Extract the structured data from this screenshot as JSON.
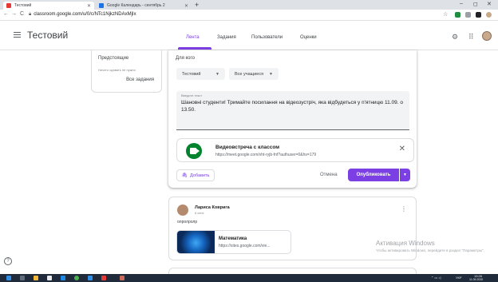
{
  "browser": {
    "tabs": [
      {
        "title": "Тестовий",
        "active": true,
        "color": "#e53935"
      },
      {
        "title": "Google Календарь - сентябрь 2",
        "active": false,
        "color": "#1a73e8"
      }
    ],
    "new_tab": "+",
    "window_controls": {
      "minimize": "–",
      "maximize": "◻",
      "close": "✕"
    },
    "nav": {
      "back": "←",
      "forward": "→",
      "reload": "C"
    },
    "url": "classroom.google.com/u/0/c/NTc1NjkzNDAxMjIx"
  },
  "header": {
    "class_title": "Тестовий",
    "tabs": [
      {
        "label": "Лента",
        "active": true
      },
      {
        "label": "Задания",
        "active": false
      },
      {
        "label": "Пользователи",
        "active": false
      },
      {
        "label": "Оценки",
        "active": false
      }
    ]
  },
  "upcoming": {
    "title": "Предстоящие",
    "subtitle": "Ничего сдавать не нужно",
    "all_tasks": "Все задания"
  },
  "composer": {
    "for_whom_label": "Для кого",
    "class_select": "Тестовий",
    "students_select": "Все учащиеся",
    "text_placeholder": "Введите текст",
    "text_value": "Шановні студенти! Тримайте посилання на відеозустріч, яка відбудеться у п'ятницю 11.09. о 13.50.",
    "attachment": {
      "title": "Видеовстреча с классом",
      "url": "https://meet.google.com/vht-ryjb-fnf?authuser=0&hs=179"
    },
    "add_label": "Добавить",
    "cancel_label": "Отмена",
    "publish_label": "Опубликовать"
  },
  "post": {
    "author": "Лариса Коврига",
    "time": "6 сент.",
    "text": "олролролр",
    "attachment": {
      "title": "Математика",
      "url": "https://sites.google.com/vie..."
    }
  },
  "watermark": {
    "title": "Активация Windows",
    "subtitle": "Чтобы активировать Windows, перейдите в раздел \"Параметры\"."
  },
  "taskbar": {
    "lang": "УКР",
    "time": "19:26",
    "date": "11.09.2020"
  },
  "colors": {
    "accent": "#7b3fe4",
    "meet_green": "#00832d"
  }
}
